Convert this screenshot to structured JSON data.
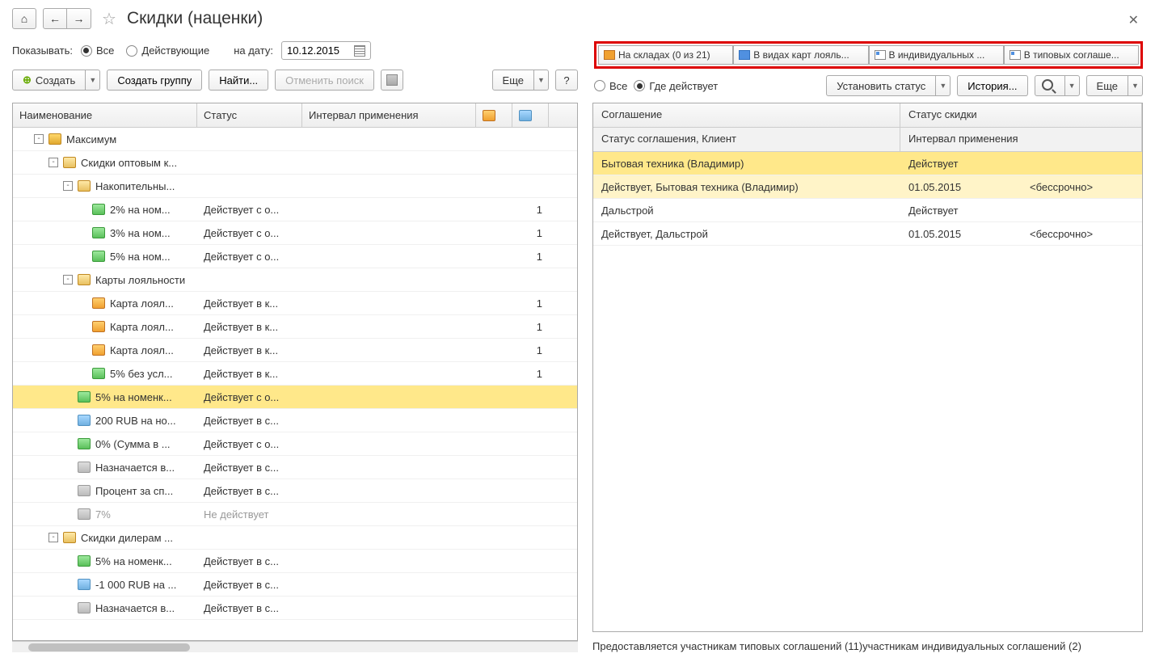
{
  "nav": {
    "home": "⌂",
    "back": "←",
    "forward": "→"
  },
  "title": "Скидки (наценки)",
  "filter": {
    "show_label": "Показывать:",
    "all": "Все",
    "active": "Действующие",
    "date_label": "на дату:",
    "date_value": "10.12.2015"
  },
  "left_toolbar": {
    "create": "Создать",
    "create_group": "Создать группу",
    "find": "Найти...",
    "cancel_search": "Отменить поиск",
    "more": "Еще"
  },
  "left_columns": {
    "name": "Наименование",
    "status": "Статус",
    "interval": "Интервал применения"
  },
  "tree": [
    {
      "indent": 1,
      "expand": "-",
      "icon": "folder",
      "name": "Максимум",
      "status": "",
      "c1": "",
      "c2": ""
    },
    {
      "indent": 2,
      "expand": "-",
      "icon": "folder-o",
      "name": "Скидки оптовым к...",
      "status": "",
      "c1": "",
      "c2": ""
    },
    {
      "indent": 3,
      "expand": "-",
      "icon": "folder-o",
      "name": "Накопительны...",
      "status": "",
      "c1": "",
      "c2": ""
    },
    {
      "indent": 4,
      "expand": "",
      "icon": "disc",
      "name": "2% на ном...",
      "status": "Действует с о...",
      "c1": "",
      "c2": "1"
    },
    {
      "indent": 4,
      "expand": "",
      "icon": "disc",
      "name": "3% на ном...",
      "status": "Действует с о...",
      "c1": "",
      "c2": "1"
    },
    {
      "indent": 4,
      "expand": "",
      "icon": "disc",
      "name": "5% на ном...",
      "status": "Действует с о...",
      "c1": "",
      "c2": "1"
    },
    {
      "indent": 3,
      "expand": "-",
      "icon": "folder-o",
      "name": "Карты лояльности",
      "status": "",
      "c1": "",
      "c2": ""
    },
    {
      "indent": 4,
      "expand": "",
      "icon": "card",
      "name": "Карта лоял...",
      "status": "Действует в к...",
      "c1": "",
      "c2": "1"
    },
    {
      "indent": 4,
      "expand": "",
      "icon": "card",
      "name": "Карта лоял...",
      "status": "Действует в к...",
      "c1": "",
      "c2": "1"
    },
    {
      "indent": 4,
      "expand": "",
      "icon": "card",
      "name": "Карта лоял...",
      "status": "Действует в к...",
      "c1": "",
      "c2": "1"
    },
    {
      "indent": 4,
      "expand": "",
      "icon": "disc",
      "name": "5% без усл...",
      "status": "Действует в к...",
      "c1": "",
      "c2": "1"
    },
    {
      "indent": 3,
      "expand": "",
      "icon": "disc",
      "name": "5% на номенк...",
      "status": "Действует с о...",
      "c1": "",
      "c2": "",
      "selected": true
    },
    {
      "indent": 3,
      "expand": "",
      "icon": "ruble",
      "name": "200 RUB на но...",
      "status": "Действует в с...",
      "c1": "",
      "c2": ""
    },
    {
      "indent": 3,
      "expand": "",
      "icon": "disc",
      "name": "0% (Сумма в ...",
      "status": "Действует с о...",
      "c1": "",
      "c2": ""
    },
    {
      "indent": 3,
      "expand": "",
      "icon": "misc",
      "name": "Назначается в...",
      "status": "Действует в с...",
      "c1": "",
      "c2": ""
    },
    {
      "indent": 3,
      "expand": "",
      "icon": "misc",
      "name": "Процент за сп...",
      "status": "Действует в с...",
      "c1": "",
      "c2": ""
    },
    {
      "indent": 3,
      "expand": "",
      "icon": "misc",
      "name": "7%",
      "status": "Не действует",
      "c1": "",
      "c2": "",
      "inactive": true
    },
    {
      "indent": 2,
      "expand": "-",
      "icon": "folder-o",
      "name": "Скидки дилерам ...",
      "status": "",
      "c1": "",
      "c2": ""
    },
    {
      "indent": 3,
      "expand": "",
      "icon": "disc",
      "name": "5% на номенк...",
      "status": "Действует в с...",
      "c1": "",
      "c2": ""
    },
    {
      "indent": 3,
      "expand": "",
      "icon": "ruble",
      "name": "-1 000 RUB на ...",
      "status": "Действует в с...",
      "c1": "",
      "c2": ""
    },
    {
      "indent": 3,
      "expand": "",
      "icon": "misc",
      "name": "Назначается в...",
      "status": "Действует в с...",
      "c1": "",
      "c2": ""
    }
  ],
  "tabs": {
    "warehouses": "На складах (0 из 21)",
    "loyalty": "В видах карт лояль...",
    "individual": "В индивидуальных ...",
    "typical": "В типовых соглаше..."
  },
  "right_toolbar": {
    "all": "Все",
    "where": "Где действует",
    "set_status": "Установить статус",
    "history": "История...",
    "more": "Еще"
  },
  "right_columns": {
    "agreement": "Соглашение",
    "discount_status": "Статус скидки",
    "agreement_status": "Статус соглашения, Клиент",
    "interval": "Интервал применения"
  },
  "right_rows": [
    {
      "cls": "hl1",
      "c1": "Бытовая техника (Владимир)",
      "c2": "Действует",
      "c3": ""
    },
    {
      "cls": "hl2",
      "c1": "Действует, Бытовая техника (Владимир)",
      "c2": "01.05.2015",
      "c3": "<бессрочно>"
    },
    {
      "cls": "",
      "c1": "Дальстрой",
      "c2": "Действует",
      "c3": ""
    },
    {
      "cls": "",
      "c1": "Действует, Дальстрой",
      "c2": "01.05.2015",
      "c3": "<бессрочно>"
    }
  ],
  "footer": "Предоставляется участникам типовых соглашений (11)участникам индивидуальных соглашений (2)"
}
